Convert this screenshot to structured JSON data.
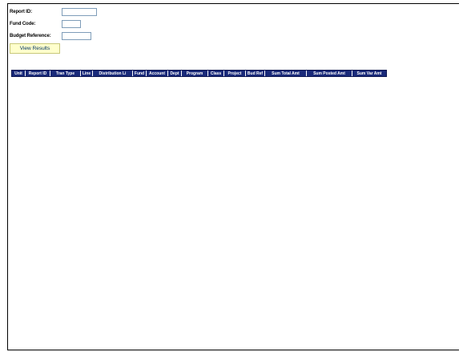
{
  "form": {
    "report_id_label": "Report ID:",
    "report_id_value": "",
    "fund_code_label": "Fund Code:",
    "fund_code_value": "",
    "budget_reference_label": "Budget Reference:",
    "budget_reference_value": "",
    "view_results_label": "View Results"
  },
  "grid": {
    "columns": [
      "Unit",
      "Report ID",
      "Tran Type",
      "Line",
      "Distribution Li",
      "Fund",
      "Account",
      "Dept",
      "Program",
      "Class",
      "Project",
      "Bud Ref",
      "Sum Total Amt",
      "Sum Posted Amt",
      "Sum Var Amt"
    ],
    "header_color": "#1a2a7a"
  }
}
